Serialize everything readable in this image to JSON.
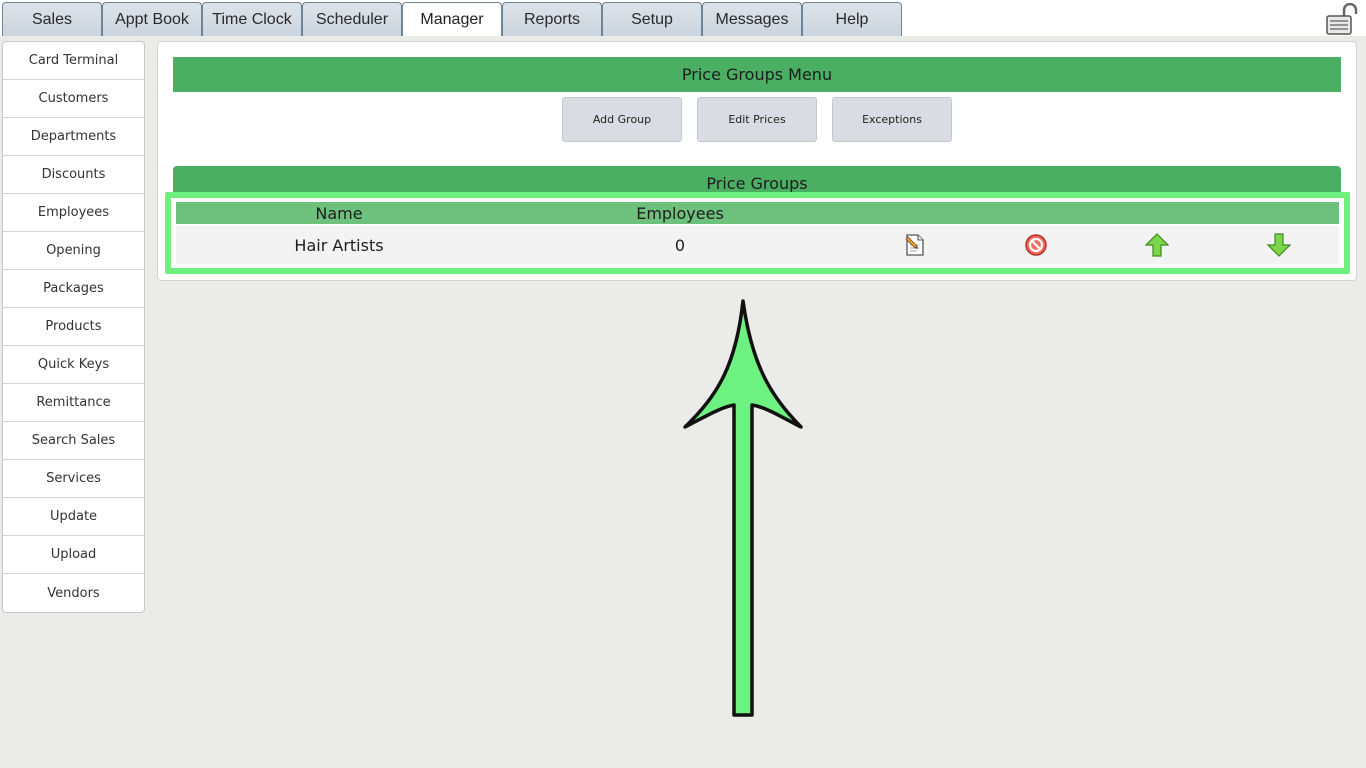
{
  "tabs": [
    {
      "label": "Sales"
    },
    {
      "label": "Appt Book"
    },
    {
      "label": "Time Clock"
    },
    {
      "label": "Scheduler"
    },
    {
      "label": "Manager",
      "active": true
    },
    {
      "label": "Reports"
    },
    {
      "label": "Setup"
    },
    {
      "label": "Messages"
    },
    {
      "label": "Help"
    }
  ],
  "header": {
    "lock_icon": "unlocked-padlock-icon"
  },
  "sidebar": {
    "items": [
      {
        "label": "Card Terminal"
      },
      {
        "label": "Customers"
      },
      {
        "label": "Departments"
      },
      {
        "label": "Discounts"
      },
      {
        "label": "Employees"
      },
      {
        "label": "Opening"
      },
      {
        "label": "Packages"
      },
      {
        "label": "Products"
      },
      {
        "label": "Quick Keys"
      },
      {
        "label": "Remittance"
      },
      {
        "label": "Search Sales"
      },
      {
        "label": "Services"
      },
      {
        "label": "Update"
      },
      {
        "label": "Upload"
      },
      {
        "label": "Vendors"
      }
    ]
  },
  "main": {
    "menu_title": "Price Groups Menu",
    "buttons": {
      "add_group": "Add Group",
      "edit_prices": "Edit Prices",
      "exceptions": "Exceptions"
    },
    "table_title": "Price Groups",
    "columns": {
      "name": "Name",
      "employees": "Employees"
    },
    "rows": [
      {
        "name": "Hair Artists",
        "employees": "0",
        "icons": [
          "edit-document-icon",
          "delete-circle-icon",
          "move-up-arrow-icon",
          "move-down-arrow-icon"
        ]
      }
    ]
  },
  "colors": {
    "header_green": "#4aaf63",
    "table_header_green": "#6ec07d",
    "highlight": "#6ef07f",
    "arrow_fill": "#6df282"
  }
}
